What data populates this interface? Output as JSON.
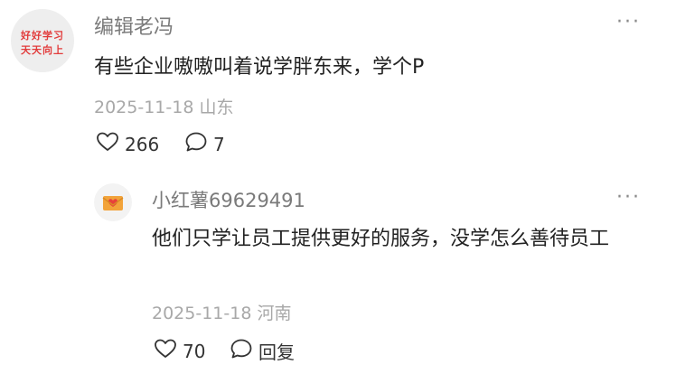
{
  "comment": {
    "avatar": {
      "line1": "好好学习",
      "line2": "天天向上"
    },
    "username": "编辑老冯",
    "more_label": "···",
    "text": "有些企业嗷嗷叫着说学胖东来，学个P",
    "date": "2025-11-18",
    "location": "山东",
    "likes": "266",
    "comments": "7",
    "like_icon": "heart-icon",
    "comment_icon": "comment-bubble-icon"
  },
  "reply": {
    "avatar_icon": "mail-heart-icon",
    "username": "小红薯69629491",
    "more_label": "···",
    "text": "他们只学让员工提供更好的服务，没学怎么善待员工",
    "date": "2025-11-18",
    "location": "河南",
    "likes": "70",
    "reply_label": "回复",
    "colors": {
      "envelope": "#f2a33a",
      "heart": "#e8413b"
    }
  }
}
